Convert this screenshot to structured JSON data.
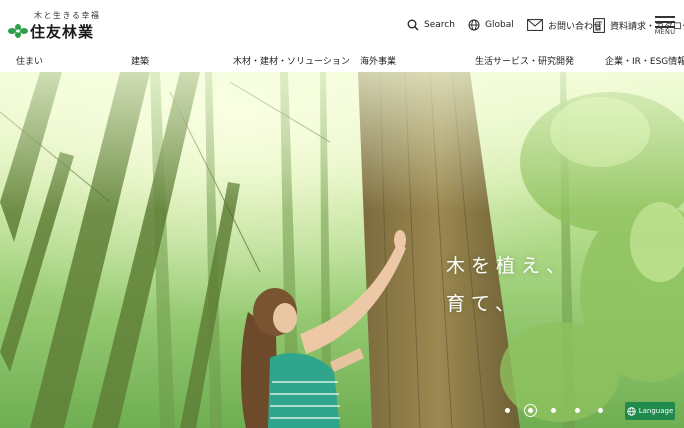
{
  "header": {
    "logo_tagline": "木と生きる幸福",
    "logo_text": "住友林業",
    "search_label": "Search",
    "global_label": "Global",
    "contact_label": "お問い合わせ",
    "catalog_label": "資料請求・カタログ",
    "menu_label": "MENU"
  },
  "nav": {
    "items": [
      {
        "label": "住まい"
      },
      {
        "label": "建築"
      },
      {
        "label": "木材・建材・ソリューション"
      },
      {
        "label": "海外事業"
      },
      {
        "label": "生活サービス・研究開発"
      },
      {
        "label": "企業・IR・ESG情報"
      }
    ]
  },
  "hero": {
    "catch_line1": "木を植え、",
    "catch_line2": "育て、",
    "slides_total": 5,
    "active_slide": 2
  },
  "language_button": "Language",
  "colors": {
    "brand_green": "#1f8a4c",
    "logo_green": "#2e9e4a"
  }
}
